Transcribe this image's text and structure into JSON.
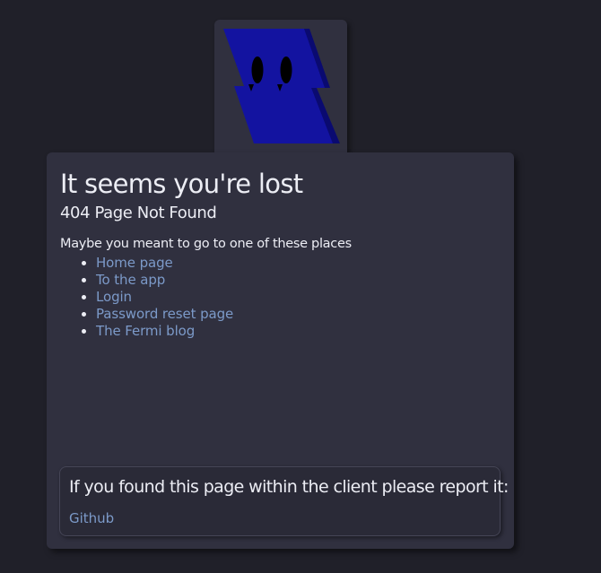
{
  "logo": {
    "icon": "blue-ghost-logo",
    "colors": {
      "body": "#1313a0",
      "shadow": "#0a0a70",
      "eyes": "#000000"
    }
  },
  "heading": {
    "title": "It seems you're lost",
    "subtitle": "404 Page Not Found"
  },
  "suggestions": {
    "intro": "Maybe you meant to go to one of these places",
    "links": [
      {
        "label": "Home page"
      },
      {
        "label": "To the app"
      },
      {
        "label": "Login"
      },
      {
        "label": "Password reset page"
      },
      {
        "label": "The Fermi blog"
      }
    ]
  },
  "report": {
    "title": "If you found this page within the client please report it:",
    "link_label": "Github"
  },
  "colors": {
    "background": "#202029",
    "card": "#30303f",
    "text": "#ecedf4",
    "link": "#7c9ac9"
  }
}
